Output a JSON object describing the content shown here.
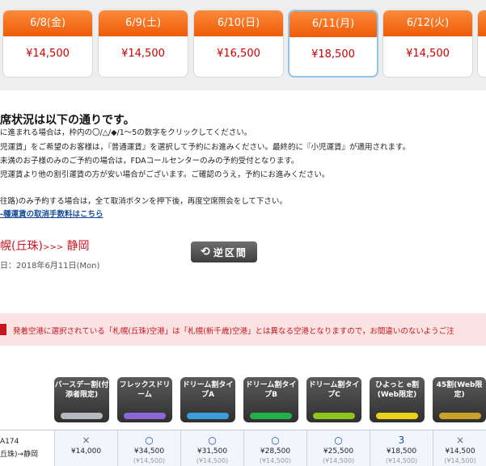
{
  "dates": [
    {
      "day": "6/8(金)",
      "price": "¥14,500",
      "selected": false
    },
    {
      "day": "6/9(土)",
      "price": "¥14,500",
      "selected": false
    },
    {
      "day": "6/10(日)",
      "price": "¥16,500",
      "selected": false
    },
    {
      "day": "6/11(月)",
      "price": "¥18,500",
      "selected": true
    },
    {
      "day": "6/12(火)",
      "price": "¥14,500",
      "selected": false
    }
  ],
  "status": {
    "title": "席状況は以下の通りです。",
    "notes": [
      "に進まれる場合は，枠内の〇/△/◆/1〜5の数字をクリックしてください。",
      "児運賃」をご希望のお客様は，『普通運賃』を選択して予約にお進みください。最終的に『小児運賃』が適用されます。",
      "未満のお子様のみのご予約の場合は，FDAコールセンターのみの予約受付となります。",
      "児運賃より他の割引運賃の方が安い場合がございます。ご確認のうえ，予約にお進みください。",
      "往路)のみ予約する場合は，全て取消ボタンを押下後，再度空席照会をして下さい。"
    ],
    "fee_link": "-種運賃の取消手数料はこちら"
  },
  "route": {
    "origin": "幌(丘珠)",
    "arrow": ">>>",
    "destination": "静岡",
    "date_text": "日：2018年6月11日(Mon)",
    "reverse_label": "逆区間"
  },
  "warning": "発着空港に選択されている「札幌(丘珠)空港」は「札幌(新千歳)空港」とは異なる空港となりますので，お間違いのないようご注",
  "fare_types": [
    {
      "label": "バースデー割(付添者限定)",
      "color": "#b5b9bd"
    },
    {
      "label": "フレックスドリーム",
      "color": "#8b67d8"
    },
    {
      "label": "ドリーム割タイプA",
      "color": "#3b9ddc"
    },
    {
      "label": "ドリーム割タイプB",
      "color": "#21b04a"
    },
    {
      "label": "ドリーム割タイプC",
      "color": "#8fc31f"
    },
    {
      "label": "ひよっと e割(Web限定)",
      "color": "#e8d21a"
    },
    {
      "label": "45割(Web限定)",
      "color": "#c9a227"
    }
  ],
  "flight": {
    "number": "A174",
    "route": "丘珠)→静岡",
    "cells": [
      {
        "mark": "×",
        "price": "¥14,000",
        "sub": ""
      },
      {
        "mark": "○",
        "price": "¥34,500",
        "sub": "(¥14,500)"
      },
      {
        "mark": "○",
        "price": "¥31,500",
        "sub": "(¥14,500)"
      },
      {
        "mark": "○",
        "price": "¥28,500",
        "sub": "(¥14,500)"
      },
      {
        "mark": "○",
        "price": "¥25,500",
        "sub": "(¥14,500)"
      },
      {
        "mark": "3",
        "price": "¥18,500",
        "sub": "(¥14,500)"
      },
      {
        "mark": "×",
        "price": "¥14,500",
        "sub": "(¥14,500)"
      }
    ]
  }
}
